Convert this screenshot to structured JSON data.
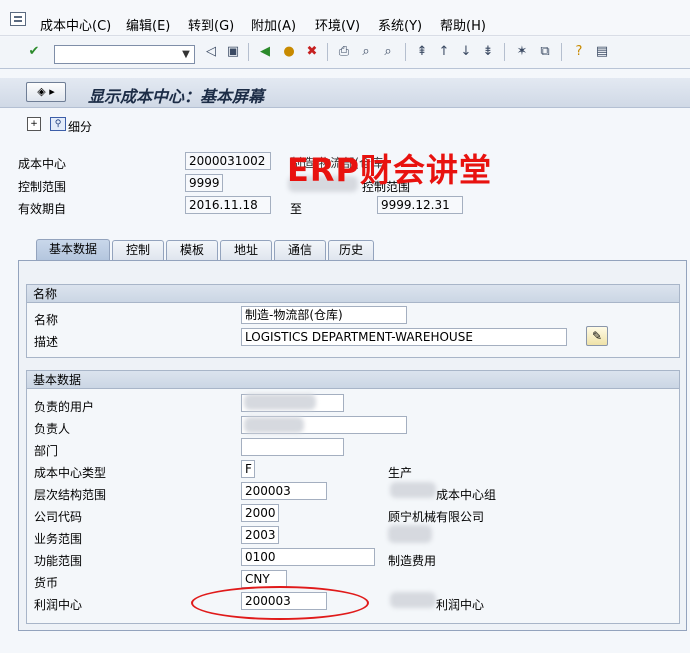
{
  "menu": [
    "成本中心(C)",
    "编辑(E)",
    "转到(G)",
    "附加(A)",
    "环境(V)",
    "系统(Y)",
    "帮助(H)"
  ],
  "title": "显示成本中心：基本屏幕",
  "app_toolbar": {
    "detail_label": "细分"
  },
  "header": {
    "cost_center_label": "成本中心",
    "cost_center_value": "2000031002",
    "cost_center_desc": "制造-物流部(仓库)",
    "controlling_area_label": "控制范围",
    "controlling_area_value": "9999",
    "controlling_area_desc": "控制范围",
    "valid_from_label": "有效期自",
    "valid_from_value": "2016.11.18",
    "to_label": "至",
    "valid_to_value": "9999.12.31"
  },
  "watermark": "ERP财会讲堂",
  "tabs": [
    "基本数据",
    "控制",
    "模板",
    "地址",
    "通信",
    "历史"
  ],
  "names_group": {
    "title": "名称",
    "name_label": "名称",
    "name_value": "制造-物流部(仓库)",
    "desc_label": "描述",
    "desc_value": "LOGISTICS DEPARTMENT-WAREHOUSE"
  },
  "basic_group": {
    "title": "基本数据",
    "rows": [
      {
        "label": "负责的用户",
        "value": "",
        "desc": ""
      },
      {
        "label": "负责人",
        "value": "",
        "desc": ""
      },
      {
        "label": "部门",
        "value": "",
        "desc": ""
      },
      {
        "label": "成本中心类型",
        "value": "F",
        "desc": "生产"
      },
      {
        "label": "层次结构范围",
        "value": "200003",
        "desc": "成本中心组"
      },
      {
        "label": "公司代码",
        "value": "2000",
        "desc": "顾宁机械有限公司"
      },
      {
        "label": "业务范围",
        "value": "2003",
        "desc": ""
      },
      {
        "label": "功能范围",
        "value": "0100",
        "desc": "制造费用"
      },
      {
        "label": "货币",
        "value": "CNY",
        "desc": ""
      },
      {
        "label": "利润中心",
        "value": "200003",
        "desc": "利润中心"
      }
    ]
  },
  "colors": {
    "watermark": "#e8120f",
    "highlight_circle": "#e01a1a"
  }
}
